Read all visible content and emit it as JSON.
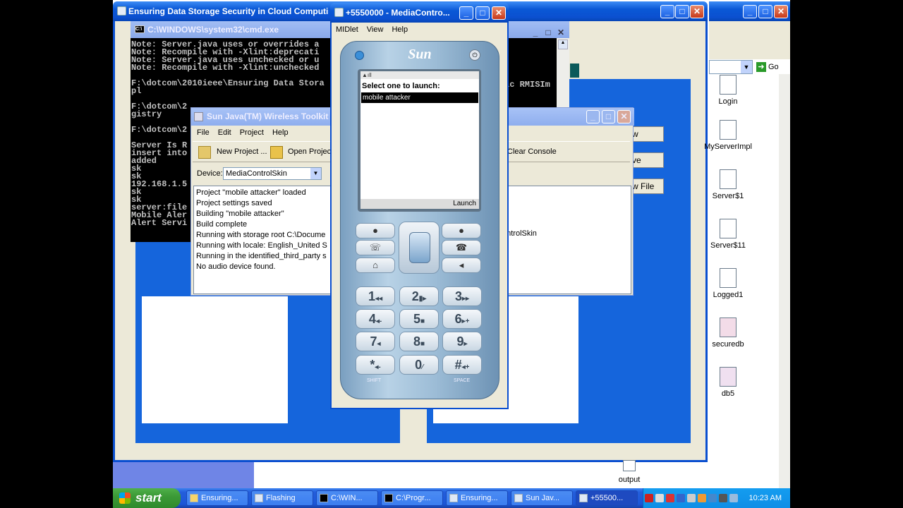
{
  "windows": {
    "main_title": "Ensuring Data Storage Security in Cloud Computi",
    "cmd_title": "C:\\WINDOWS\\system32\\cmd.exe",
    "toolkit_title": "Sun Java(TM) Wireless Toolkit",
    "emulator_title": "+5550000 - MediaContro..."
  },
  "cmd": {
    "lines": "Note: Server.java uses or overrides a\nNote: Recompile with -Xlint:deprecati\nNote: Server.java uses unchecked or u\nNote: Recompile with -Xlint:unchecked\n\nF:\\dotcom\\2010ieee\\Ensuring Data Stora\npl\n\nF:\\dotcom\\2\ngistry\n\nF:\\dotcom\\2\n\nServer Is R\ninsert into\nadded\nsk\nsk\n192.168.1.5\nsk\nsk\nserver:file\nMobile Aler\nAlert Servi",
    "right_fragment": "ic RMISIm"
  },
  "toolkit": {
    "menu": [
      "File",
      "Edit",
      "Project",
      "Help"
    ],
    "new_project": "New Project ...",
    "open_project": "Open Project",
    "clear_console": "Clear Console",
    "device_label": "Device:",
    "device_value": "MediaControlSkin",
    "console": "Project \"mobile attacker\" loaded\nProject settings saved\nBuilding \"mobile attacker\"\nBuild complete\nRunning with storage root C:\\Docume\nRunning with locale: English_United S\nRunning in the identified_third_party s\nNo audio device found.",
    "console_right": "ontrolSkin"
  },
  "background_buttons": [
    "w",
    "ve",
    "w File"
  ],
  "address_go": "Go",
  "emulator": {
    "menu": [
      "MIDlet",
      "View",
      "Help"
    ],
    "brand": "Sun",
    "lcd_heading": "Select one to launch:",
    "lcd_item": "mobile attacker",
    "softkey": "Launch",
    "keys": [
      {
        "k": "1",
        "g": "◂◂"
      },
      {
        "k": "2",
        "g": "▮▸"
      },
      {
        "k": "3",
        "g": "▸▸"
      },
      {
        "k": "4",
        "g": "◂-"
      },
      {
        "k": "5",
        "g": "■"
      },
      {
        "k": "6",
        "g": "▸+"
      },
      {
        "k": "7",
        "g": "◂"
      },
      {
        "k": "8",
        "g": "■"
      },
      {
        "k": "9",
        "g": "▸"
      },
      {
        "k": "*",
        "g": "◂-"
      },
      {
        "k": "0",
        "g": "⁄"
      },
      {
        "k": "#",
        "g": "◂+"
      }
    ],
    "shift_label": "SHIFT",
    "space_label": "SPACE"
  },
  "desktop_icons": [
    "Login",
    "MyServerImpl",
    "Server$1",
    "Server$11",
    "Logged1",
    "securedb",
    "db5",
    "output"
  ],
  "taskbar": {
    "start": "start",
    "items": [
      "Ensuring...",
      "Flashing",
      "C:\\WIN...",
      "C:\\Progr...",
      "Ensuring...",
      "Sun Jav...",
      "+55500..."
    ],
    "clock": "10:23 AM"
  }
}
